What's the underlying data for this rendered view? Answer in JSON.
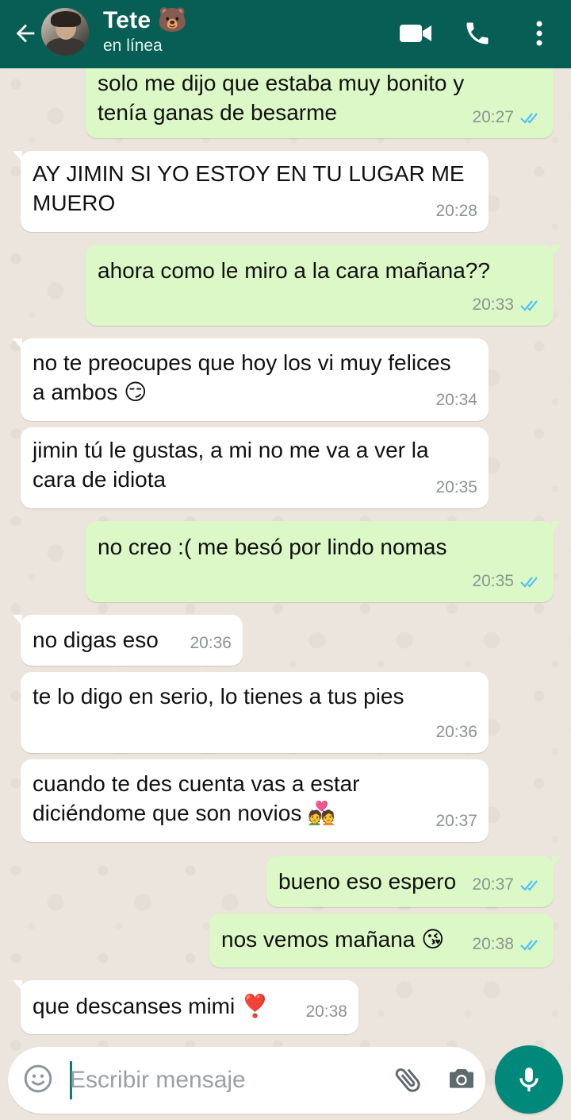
{
  "header": {
    "contact_name": "Tete 🐻",
    "status": "en línea"
  },
  "messages": [
    {
      "dir": "out",
      "text": "solo me dijo que estaba muy bonito y\ntenía ganas de besarme",
      "time": "20:27",
      "read": true
    },
    {
      "dir": "in",
      "text": "AY JIMIN SI YO ESTOY EN TU LUGAR ME\nMUERO",
      "time": "20:28"
    },
    {
      "dir": "out",
      "text": "ahora como le miro a la cara mañana??",
      "time": "20:33",
      "read": true
    },
    {
      "dir": "in",
      "text": "no te preocupes que hoy los vi muy felices\na ambos 😏",
      "time": "20:34"
    },
    {
      "dir": "in",
      "text": "jimin tú le gustas, a mi no me va a ver la\ncara de idiota",
      "time": "20:35"
    },
    {
      "dir": "out",
      "text": "no creo :( me besó por lindo nomas",
      "time": "20:35",
      "read": true
    },
    {
      "dir": "in",
      "text": "no digas eso",
      "time": "20:36"
    },
    {
      "dir": "in",
      "text": "te lo digo en serio, lo tienes a tus pies",
      "time": "20:36"
    },
    {
      "dir": "in",
      "text": "cuando te des cuenta vas a estar\ndiciéndome que son novios 💑",
      "time": "20:37"
    },
    {
      "dir": "out",
      "text": "bueno eso espero",
      "time": "20:37",
      "read": true
    },
    {
      "dir": "out",
      "text": "nos vemos mañana 😘",
      "time": "20:38",
      "read": true
    },
    {
      "dir": "in",
      "text": "que descanses mimi ❣️",
      "time": "20:38"
    }
  ],
  "composer": {
    "placeholder": "Escribir mensaje"
  },
  "colors": {
    "header": "#075e54",
    "outgoing_bubble": "#dcf8c6",
    "incoming_bubble": "#ffffff",
    "read_ticks": "#4fc3f7",
    "mic_button": "#00897b"
  },
  "icons": [
    "back-arrow-icon",
    "video-call-icon",
    "phone-call-icon",
    "more-options-icon",
    "emoji-icon",
    "attach-icon",
    "camera-icon",
    "microphone-icon"
  ]
}
